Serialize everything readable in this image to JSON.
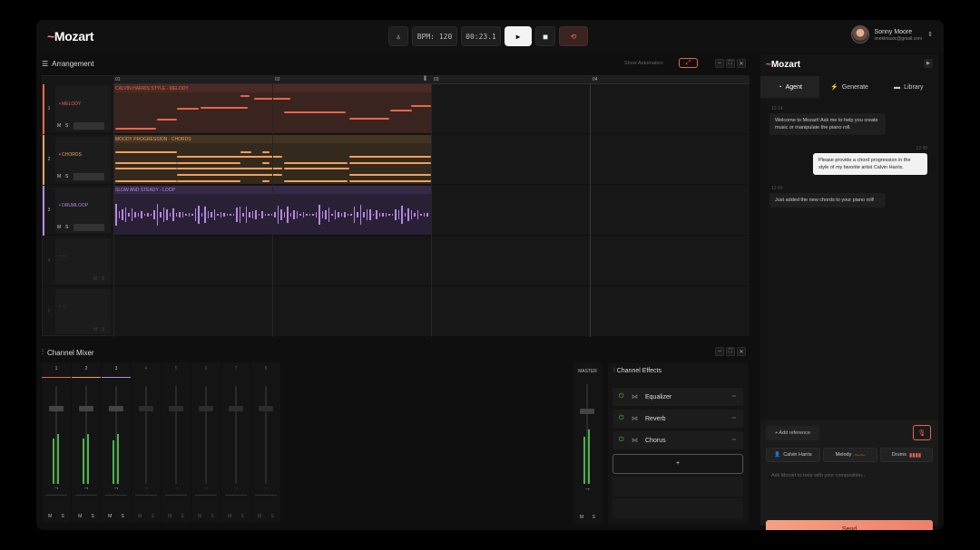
{
  "app": {
    "logo": "Mozart",
    "bpm_label": "BPM: 120",
    "time": "00:23.1",
    "user_name": "Sonny Moore",
    "user_email": "imekimusic@gmail.com"
  },
  "arrangement": {
    "title": "Arrangement",
    "show_automation": "Show Automation",
    "ruler": [
      "01",
      "02",
      "03",
      "04"
    ],
    "tracks": [
      {
        "num": "1",
        "name": "• MELODY",
        "clip": "CALVIN HARRIS STYLE - MELODY"
      },
      {
        "num": "2",
        "name": "• CHORDS",
        "clip": "MOODY PROGRESSION - CHORDS"
      },
      {
        "num": "3",
        "name": "• DRUMLOOP",
        "clip": "SLOW AND STEADY - LOOP"
      },
      {
        "num": "4",
        "name": "• ---",
        "clip": ""
      },
      {
        "num": "5",
        "name": "• ---",
        "clip": ""
      }
    ],
    "mute": "M",
    "solo": "S"
  },
  "mixer": {
    "title": "Channel Mixer",
    "channels": [
      "1",
      "2",
      "3",
      "4",
      "5",
      "6",
      "7",
      "8"
    ],
    "master": "MASTER",
    "mute": "M",
    "solo": "S"
  },
  "effects": {
    "title": "Channel Effects",
    "items": [
      "Equalizer",
      "Reverb",
      "Chorus"
    ],
    "add": "+"
  },
  "assistant": {
    "logo": "Mozart",
    "tabs": [
      "Agent",
      "Generate",
      "Library"
    ],
    "messages": [
      {
        "time": "12:14",
        "text": "Welcome to Mozart! Ask me to help you create music or manipulate the piano roll.",
        "from": "ai"
      },
      {
        "time": "12:48",
        "text": "Please provide a chord progression in the style of my favorite artist Calvin Harris.",
        "from": "me"
      },
      {
        "time": "12:49",
        "text": "Just added the new chords to your piano roll!",
        "from": "ai"
      }
    ],
    "add_reference": "+ Add reference",
    "chips": [
      "Calvin Harris",
      "Melody",
      "Drums"
    ],
    "prompt_placeholder": "Ask Mozart to help with your composition...",
    "send": "Send"
  },
  "colors": {
    "melody": "#e8654b",
    "chords": "#f0a060",
    "drum": "#b489e0",
    "accent": "#ee7f6a"
  }
}
